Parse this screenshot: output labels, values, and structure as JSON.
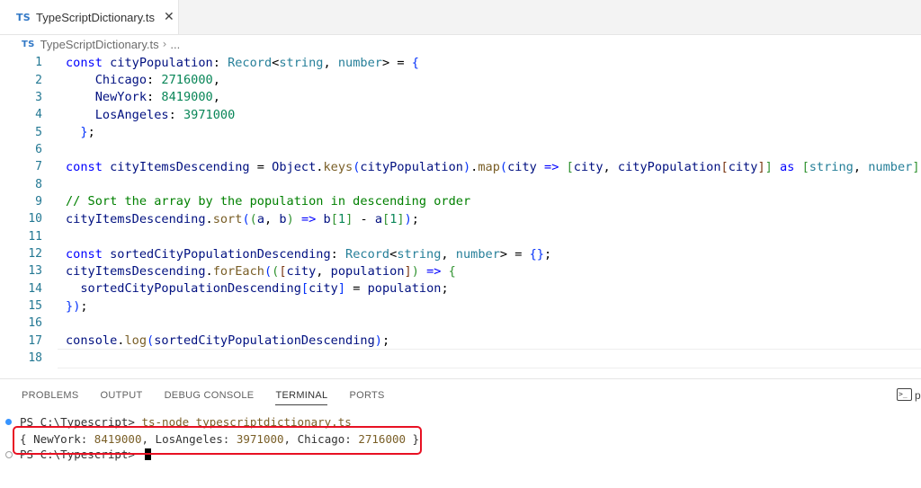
{
  "tab": {
    "icon": "TS",
    "label": "TypeScriptDictionary.ts",
    "close_glyph": "✕"
  },
  "breadcrumb": {
    "icon": "TS",
    "file": "TypeScriptDictionary.ts",
    "separator": "›",
    "more": "..."
  },
  "editor": {
    "line_numbers": [
      "1",
      "2",
      "3",
      "4",
      "5",
      "6",
      "7",
      "8",
      "9",
      "10",
      "11",
      "12",
      "13",
      "14",
      "15",
      "16",
      "17",
      "18"
    ],
    "code_lines": [
      "const cityPopulation: Record<string, number> = {",
      "    Chicago: 2716000,",
      "    NewYork: 8419000,",
      "    LosAngeles: 3971000",
      "  };",
      "",
      "const cityItemsDescending = Object.keys(cityPopulation).map(city => [city, cityPopulation[city]] as [string, number]);",
      "",
      "// Sort the array by the population in descending order",
      "cityItemsDescending.sort((a, b) => b[1] - a[1]);",
      "",
      "const sortedCityPopulationDescending: Record<string, number> = {};",
      "cityItemsDescending.forEach(([city, population]) => {",
      "  sortedCityPopulationDescending[city] = population;",
      "});",
      "",
      "console.log(sortedCityPopulationDescending);",
      ""
    ],
    "current_line": 18
  },
  "panel": {
    "tabs": [
      "PROBLEMS",
      "OUTPUT",
      "DEBUG CONSOLE",
      "TERMINAL",
      "PORTS"
    ],
    "active_tab": "TERMINAL",
    "profile_label": "p"
  },
  "terminal": {
    "line1_prompt": "PS C:\\Typescript> ",
    "line1_command": "ts-node typescriptdictionary.ts",
    "output": {
      "open": "{ ",
      "k1": "NewYork: ",
      "v1": "8419000",
      "sep1": ", ",
      "k2": "LosAngeles: ",
      "v2": "3971000",
      "sep2": ", ",
      "k3": "Chicago: ",
      "v3": "2716000",
      "close": " }"
    },
    "line3_prompt": "PS C:\\Typescript> "
  },
  "colors": {
    "accent": "#3794ff",
    "highlight_box": "#e81123",
    "ts_icon": "#3178c6"
  }
}
